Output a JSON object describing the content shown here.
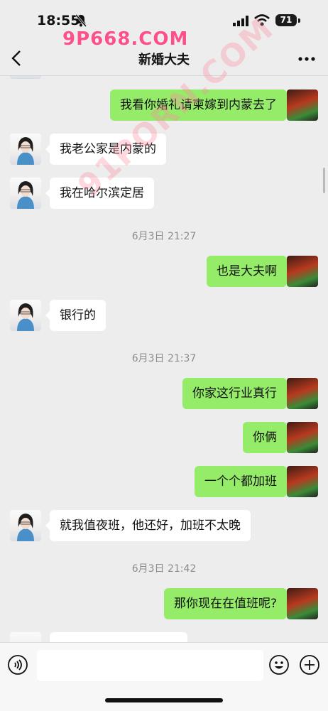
{
  "status_bar": {
    "time": "18:55",
    "battery": "71",
    "watermark": "9P668.COM"
  },
  "nav": {
    "title": "新婚大夫"
  },
  "watermark_diag": "91PORN.COM",
  "messages": [
    {
      "side": "right",
      "text": "我看你婚礼请柬嫁到内蒙去了"
    },
    {
      "side": "left",
      "text": "我老公家是内蒙的"
    },
    {
      "side": "left",
      "text": "我在哈尔滨定居"
    },
    {
      "type": "time",
      "text": "6月3日 21:27"
    },
    {
      "side": "right",
      "text": "也是大夫啊"
    },
    {
      "side": "left",
      "text": "银行的"
    },
    {
      "type": "time",
      "text": "6月3日 21:37"
    },
    {
      "side": "right",
      "text": "你家这行业真行"
    },
    {
      "side": "right",
      "text": "你俩"
    },
    {
      "side": "right",
      "text": "一个个都加班"
    },
    {
      "side": "left",
      "text": "就我值夜班，他还好，加班不太晚"
    },
    {
      "type": "time",
      "text": "6月3日 21:42"
    },
    {
      "side": "right",
      "text": "那你现在在值班呢?"
    }
  ],
  "colors": {
    "sent_bubble": "#95ec69",
    "received_bubble": "#ffffff",
    "background": "#ededed"
  },
  "icons": [
    "bell-off-icon",
    "signal-icon",
    "wifi-icon",
    "back-icon",
    "more-icon",
    "voice-icon",
    "emoji-icon",
    "plus-icon"
  ]
}
